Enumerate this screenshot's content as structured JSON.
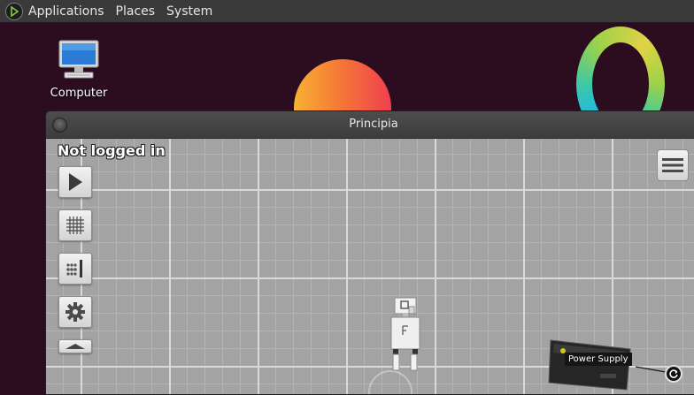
{
  "top_panel": {
    "menus": [
      "Applications",
      "Places",
      "System"
    ]
  },
  "desktop": {
    "icons": [
      {
        "label": "Computer",
        "icon": "computer-icon"
      }
    ]
  },
  "window": {
    "title": "Principia",
    "status": "Not logged in",
    "toolbar": [
      {
        "name": "play-button",
        "icon": "play-icon"
      },
      {
        "name": "grid-button",
        "icon": "grid-icon"
      },
      {
        "name": "layer-button",
        "icon": "layers-icon"
      },
      {
        "name": "settings-button",
        "icon": "gear-icon"
      },
      {
        "name": "collapse-button",
        "icon": "chevron-up-icon"
      }
    ],
    "menu_icon": "hamburger-icon",
    "scene": {
      "objects": [
        {
          "name": "robot",
          "icon": "robot-icon"
        },
        {
          "name": "power-supply",
          "label": "Power Supply"
        }
      ]
    }
  },
  "colors": {
    "panel": "#3a3a3a",
    "desktop_bg": "#2c0d1f",
    "canvas_bg": "#a3a3a3"
  }
}
